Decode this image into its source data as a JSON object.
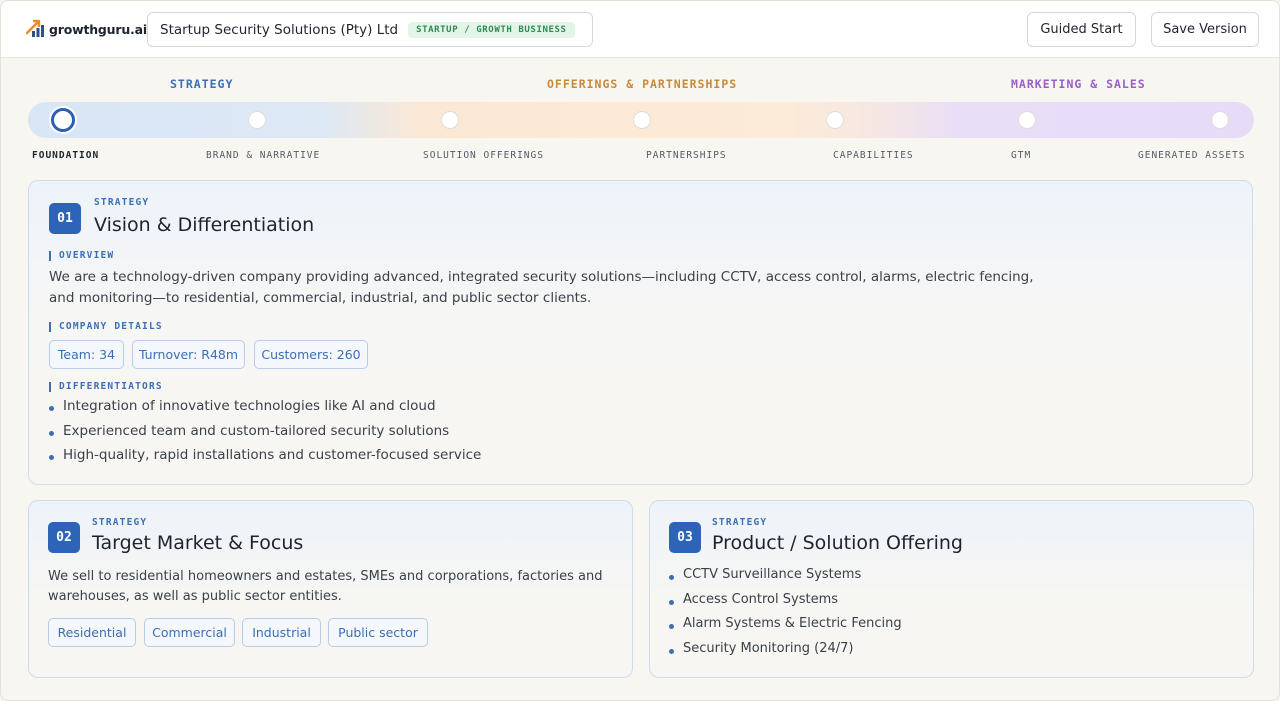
{
  "header": {
    "logo_text": "growthguru.ai",
    "company_name": "Startup Security Solutions (Pty) Ltd",
    "stage_badge": "STARTUP / GROWTH BUSINESS",
    "guided_start_label": "Guided Start",
    "save_version_label": "Save Version"
  },
  "progress": {
    "phases": [
      "STRATEGY",
      "OFFERINGS & PARTNERSHIPS",
      "MARKETING & SALES"
    ],
    "steps": [
      "FOUNDATION",
      "BRAND & NARRATIVE",
      "SOLUTION OFFERINGS",
      "PARTNERSHIPS",
      "CAPABILITIES",
      "GTM",
      "GENERATED ASSETS"
    ],
    "active_step": "FOUNDATION"
  },
  "cards": {
    "vision": {
      "number": "01",
      "eyebrow": "STRATEGY",
      "title": "Vision & Differentiation",
      "overview_label": "OVERVIEW",
      "overview_line1": "We are a technology-driven company providing advanced, integrated security solutions—including CCTV, access control, alarms, electric fencing,",
      "overview_line2": "and monitoring—to residential, commercial, industrial, and public sector clients.",
      "details_label": "COMPANY DETAILS",
      "details": [
        "Team: 34",
        "Turnover: R48m",
        "Customers: 260"
      ],
      "differentiators_label": "DIFFERENTIATORS",
      "differentiators": [
        "Integration of innovative technologies like AI and cloud",
        "Experienced team and custom-tailored security solutions",
        "High-quality, rapid installations and customer-focused service"
      ]
    },
    "target": {
      "number": "02",
      "eyebrow": "STRATEGY",
      "title": "Target Market & Focus",
      "desc_line1": "We sell to residential homeowners and estates, SMEs and corporations, factories and",
      "desc_line2": "warehouses, as well as public sector entities.",
      "segments": [
        "Residential",
        "Commercial",
        "Industrial",
        "Public sector"
      ]
    },
    "product": {
      "number": "03",
      "eyebrow": "STRATEGY",
      "title": "Product / Solution Offering",
      "items": [
        "CCTV Surveillance Systems",
        "Access Control Systems",
        "Alarm Systems & Electric Fencing",
        "Security Monitoring (24/7)"
      ]
    }
  },
  "colors": {
    "accent_blue": "#2d64b8",
    "strategy": "#3b6fb5",
    "offerings": "#c78a3c",
    "marketing": "#9a5fc7",
    "badge_green": "#2f8a54"
  }
}
